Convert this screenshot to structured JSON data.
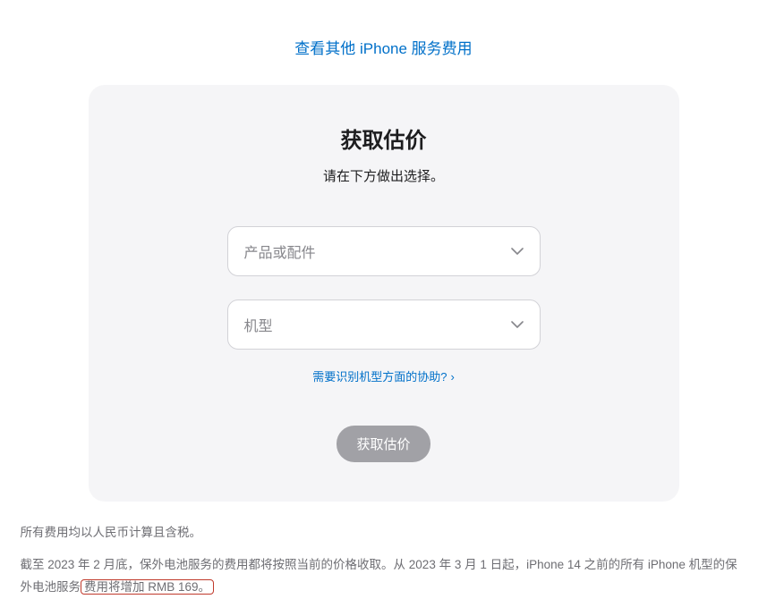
{
  "topLink": {
    "label": "查看其他 iPhone 服务费用"
  },
  "card": {
    "title": "获取估价",
    "subtitle": "请在下方做出选择。",
    "select1": {
      "placeholder": "产品或配件"
    },
    "select2": {
      "placeholder": "机型"
    },
    "helpLink": {
      "label": "需要识别机型方面的协助?"
    },
    "submit": {
      "label": "获取估价"
    }
  },
  "footnotes": {
    "line1": "所有费用均以人民币计算且含税。",
    "line2a": "截至 2023 年 2 月底，保外电池服务的费用都将按照当前的价格收取。从 2023 年 3 月 1 日起，iPhone 14 之前的所有 iPhone 机型的保外电池服务",
    "line2b": "费用将增加 RMB 169。"
  }
}
